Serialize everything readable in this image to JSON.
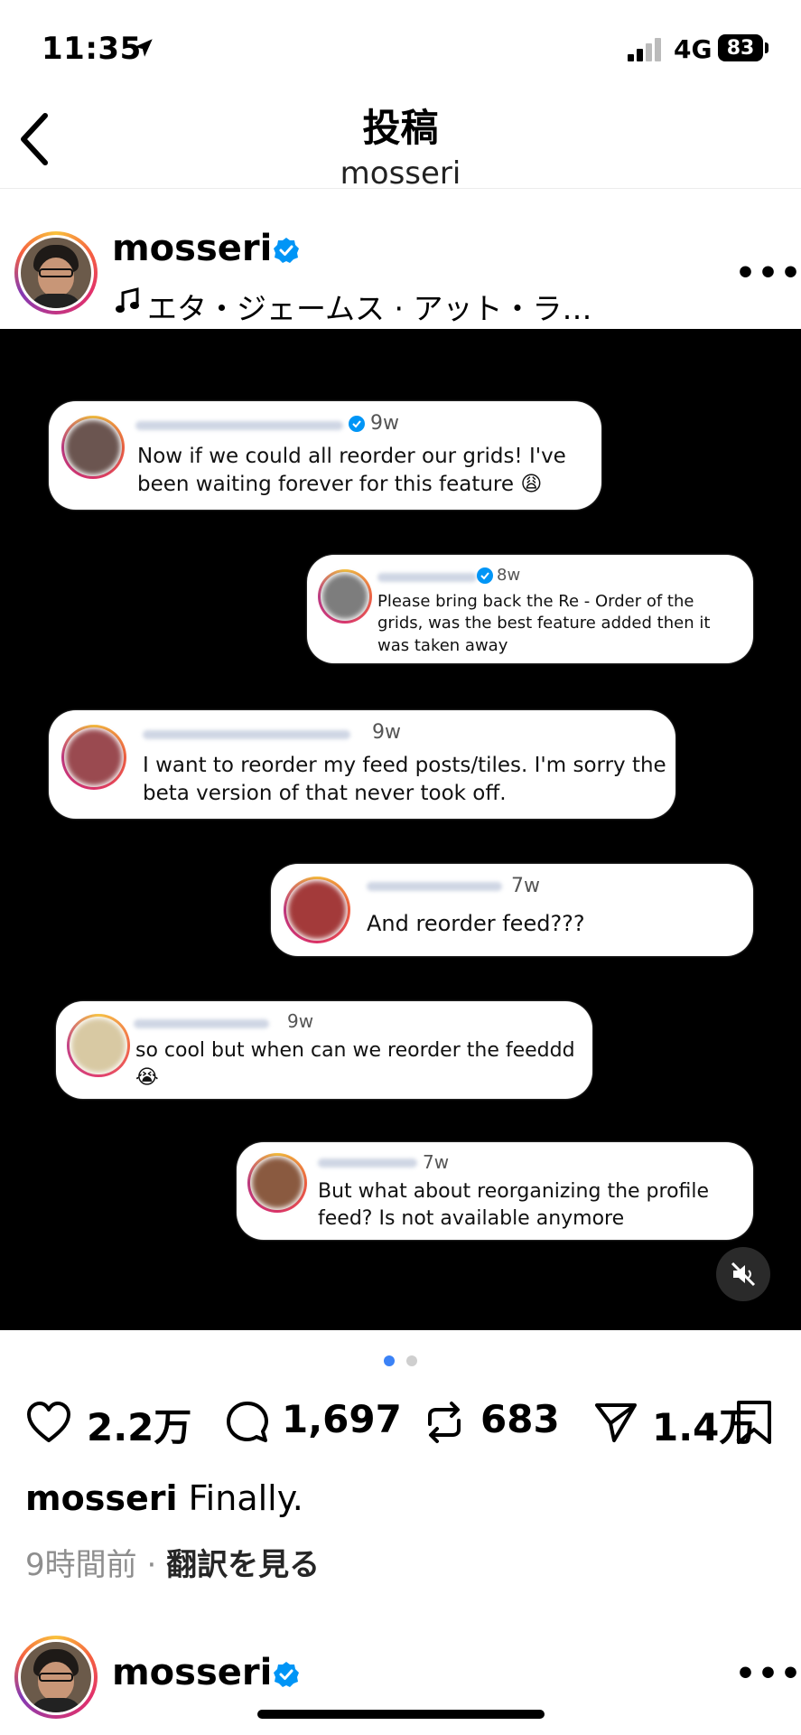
{
  "status_bar": {
    "time": "11:35",
    "network": "4G",
    "battery": "83"
  },
  "header": {
    "title": "投稿",
    "subtitle": "mosseri"
  },
  "post": {
    "username": "mosseri",
    "music": "エタ・ジェームス · アット・ラ…",
    "more": "•••",
    "comments": [
      {
        "time": "9w",
        "text": "Now if we could all reorder our grids! I've been waiting forever for this feature 😩"
      },
      {
        "time": "8w",
        "text": "Please bring back the Re - Order of the grids, was the best feature added then it was taken away"
      },
      {
        "time": "9w",
        "text": "I want to reorder my feed posts/tiles. I'm sorry the beta version of that never took off."
      },
      {
        "time": "7w",
        "text": "And reorder feed???"
      },
      {
        "time": "9w",
        "text": "so cool but when can we reorder the feeddd 😭"
      },
      {
        "time": "7w",
        "text": "But what about reorganizing the profile feed? Is not available anymore"
      }
    ],
    "carousel": {
      "current": 1,
      "total": 2
    },
    "actions": {
      "likes": "2.2万",
      "comments": "1,697",
      "reposts": "683",
      "shares": "1.4万"
    },
    "caption": {
      "username": "mosseri",
      "text": "Finally."
    },
    "meta": {
      "time": "9時間前",
      "separator": " · ",
      "translate": "翻訳を見る"
    }
  },
  "next_post": {
    "username": "mosseri",
    "more": "•••"
  },
  "colors": {
    "accent_blue": "#3b82f6",
    "verified_blue": "#0095f6"
  }
}
